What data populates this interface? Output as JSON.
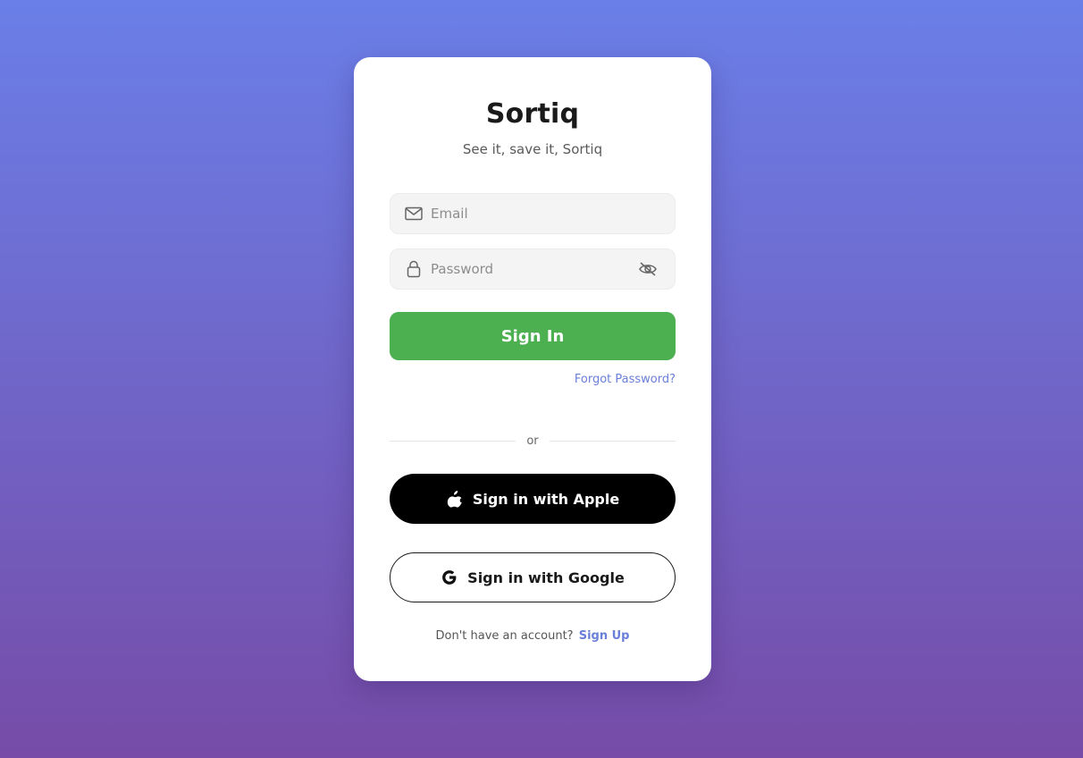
{
  "app": {
    "name": "Sortiq",
    "tagline": "See it, save it, Sortiq"
  },
  "form": {
    "email": {
      "value": "",
      "placeholder": "Email",
      "icon": "mail-icon"
    },
    "password": {
      "value": "",
      "placeholder": "Password",
      "icon": "lock-icon",
      "toggle_icon": "eye-off-icon"
    },
    "submit_label": "Sign In",
    "forgot_label": "Forgot Password?"
  },
  "divider_text": "or",
  "social": {
    "apple_label": "Sign in with Apple",
    "google_label": "Sign in with Google"
  },
  "footer": {
    "prompt": "Don't have an account?",
    "signup_label": "Sign Up"
  },
  "colors": {
    "background_top": "#6a7fe8",
    "background_bottom": "#764ca8",
    "primary": "#4caf50",
    "link": "#6a7fd8",
    "apple_button": "#000000"
  }
}
